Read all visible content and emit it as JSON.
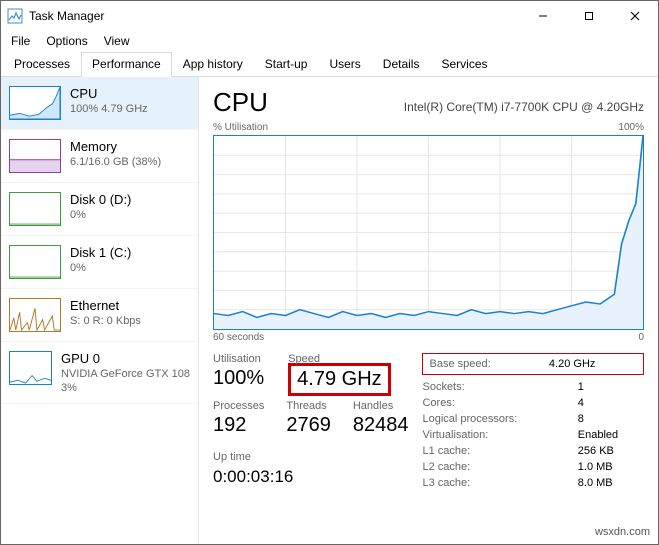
{
  "window": {
    "title": "Task Manager"
  },
  "menubar": {
    "file": "File",
    "options": "Options",
    "view": "View"
  },
  "tabs": {
    "processes": "Processes",
    "performance": "Performance",
    "app_history": "App history",
    "startup": "Start-up",
    "users": "Users",
    "details": "Details",
    "services": "Services"
  },
  "sidebar": {
    "items": [
      {
        "title": "CPU",
        "sub": "100% 4.79 GHz",
        "color": "#1b80d0"
      },
      {
        "title": "Memory",
        "sub": "6.1/16.0 GB (38%)",
        "color": "#8f3fa0"
      },
      {
        "title": "Disk 0 (D:)",
        "sub": "0%",
        "color": "#3f9b3f"
      },
      {
        "title": "Disk 1 (C:)",
        "sub": "0%",
        "color": "#3f9b3f"
      },
      {
        "title": "Ethernet",
        "sub": "S: 0  R: 0 Kbps",
        "color": "#b07a28"
      },
      {
        "title": "GPU 0",
        "sub": "NVIDIA GeForce GTX 108",
        "sub2": "3%",
        "color": "#1b80d0"
      }
    ]
  },
  "main": {
    "title": "CPU",
    "subtitle": "Intel(R) Core(TM) i7-7700K CPU @ 4.20GHz",
    "axis_tl": "% Utilisation",
    "axis_tr": "100%",
    "axis_bl": "60 seconds",
    "axis_br": "0",
    "stats_left": {
      "util_label": "Utilisation",
      "util_val": "100%",
      "speed_label": "Speed",
      "speed_val": "4.79 GHz",
      "proc_label": "Processes",
      "proc_val": "192",
      "thr_label": "Threads",
      "thr_val": "2769",
      "hnd_label": "Handles",
      "hnd_val": "82484",
      "uptime_label": "Up time",
      "uptime_val": "0:00:03:16"
    },
    "stats_right": {
      "base_label": "Base speed:",
      "base_val": "4.20 GHz",
      "sock_label": "Sockets:",
      "sock_val": "1",
      "core_label": "Cores:",
      "core_val": "4",
      "lp_label": "Logical processors:",
      "lp_val": "8",
      "virt_label": "Virtualisation:",
      "virt_val": "Enabled",
      "l1_label": "L1 cache:",
      "l1_val": "256 KB",
      "l2_label": "L2 cache:",
      "l2_val": "1.0 MB",
      "l3_label": "L3 cache:",
      "l3_val": "8.0 MB"
    }
  },
  "watermark": "wsxdn.com",
  "chart_data": {
    "type": "line",
    "title": "% Utilisation",
    "xlabel": "60 seconds",
    "ylabel": "",
    "ylim": [
      0,
      100
    ],
    "xlim": [
      60,
      0
    ],
    "series": [
      {
        "name": "CPU Utilisation",
        "x": [
          60,
          58,
          56,
          54,
          52,
          50,
          48,
          46,
          44,
          42,
          40,
          38,
          36,
          34,
          32,
          30,
          28,
          26,
          24,
          22,
          20,
          18,
          16,
          14,
          12,
          10,
          8,
          6,
          4,
          3,
          2,
          1,
          0
        ],
        "values": [
          8,
          7,
          9,
          6,
          8,
          7,
          10,
          8,
          6,
          9,
          7,
          8,
          6,
          8,
          7,
          9,
          8,
          7,
          10,
          8,
          9,
          8,
          9,
          8,
          10,
          12,
          14,
          13,
          18,
          44,
          56,
          65,
          100
        ]
      }
    ]
  }
}
